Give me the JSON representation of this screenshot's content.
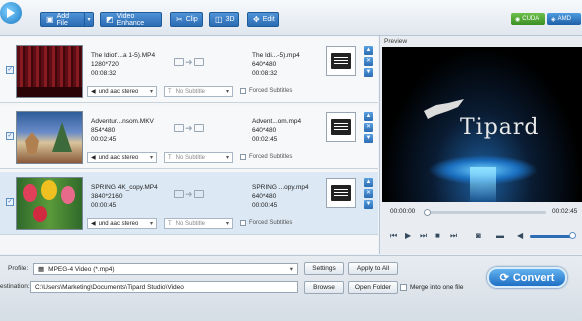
{
  "toolbar": {
    "add_file": "Add File",
    "video_enhance": "Video Enhance",
    "clip": "Clip",
    "threed": "3D",
    "edit": "Edit",
    "cuda": "CUDA",
    "amd": "AMD"
  },
  "files": [
    {
      "name": "The Idiot'...a 1-5).MP4",
      "resolution": "1280*720",
      "duration": "00:08:32",
      "out_name": "The Idi...-5).mp4",
      "out_resolution": "640*480",
      "out_duration": "00:08:32",
      "audio": "und aac stereo",
      "subtitle": "No Subtitle",
      "forced": "Forced Subtitles"
    },
    {
      "name": "Adventur...nsom.MKV",
      "resolution": "854*480",
      "duration": "00:02:45",
      "out_name": "Advent...om.mp4",
      "out_resolution": "640*480",
      "out_duration": "00:02:45",
      "audio": "und aac stereo",
      "subtitle": "No Subtitle",
      "forced": "Forced Subtitles"
    },
    {
      "name": "SPRING 4K_copy.MP4",
      "resolution": "3840*2160",
      "duration": "00:00:45",
      "out_name": "SPRING ...opy.mp4",
      "out_resolution": "640*480",
      "out_duration": "00:00:45",
      "audio": "und aac stereo",
      "subtitle": "No Subtitle",
      "forced": "Forced Subtitles"
    }
  ],
  "preview": {
    "title": "Preview",
    "brand": "Tipard",
    "time_current": "00:00:00",
    "time_total": "00:02:45"
  },
  "bottom": {
    "profile_label": "Profile:",
    "profile_value": "MPEG-4 Video (*.mp4)",
    "settings": "Settings",
    "apply_all": "Apply to All",
    "dest_label": "estination:",
    "dest_value": "C:\\Users\\Marketing\\Documents\\Tipard Studio\\Video",
    "browse": "Browse",
    "open_folder": "Open Folder",
    "merge": "Merge into one file",
    "convert": "Convert"
  }
}
